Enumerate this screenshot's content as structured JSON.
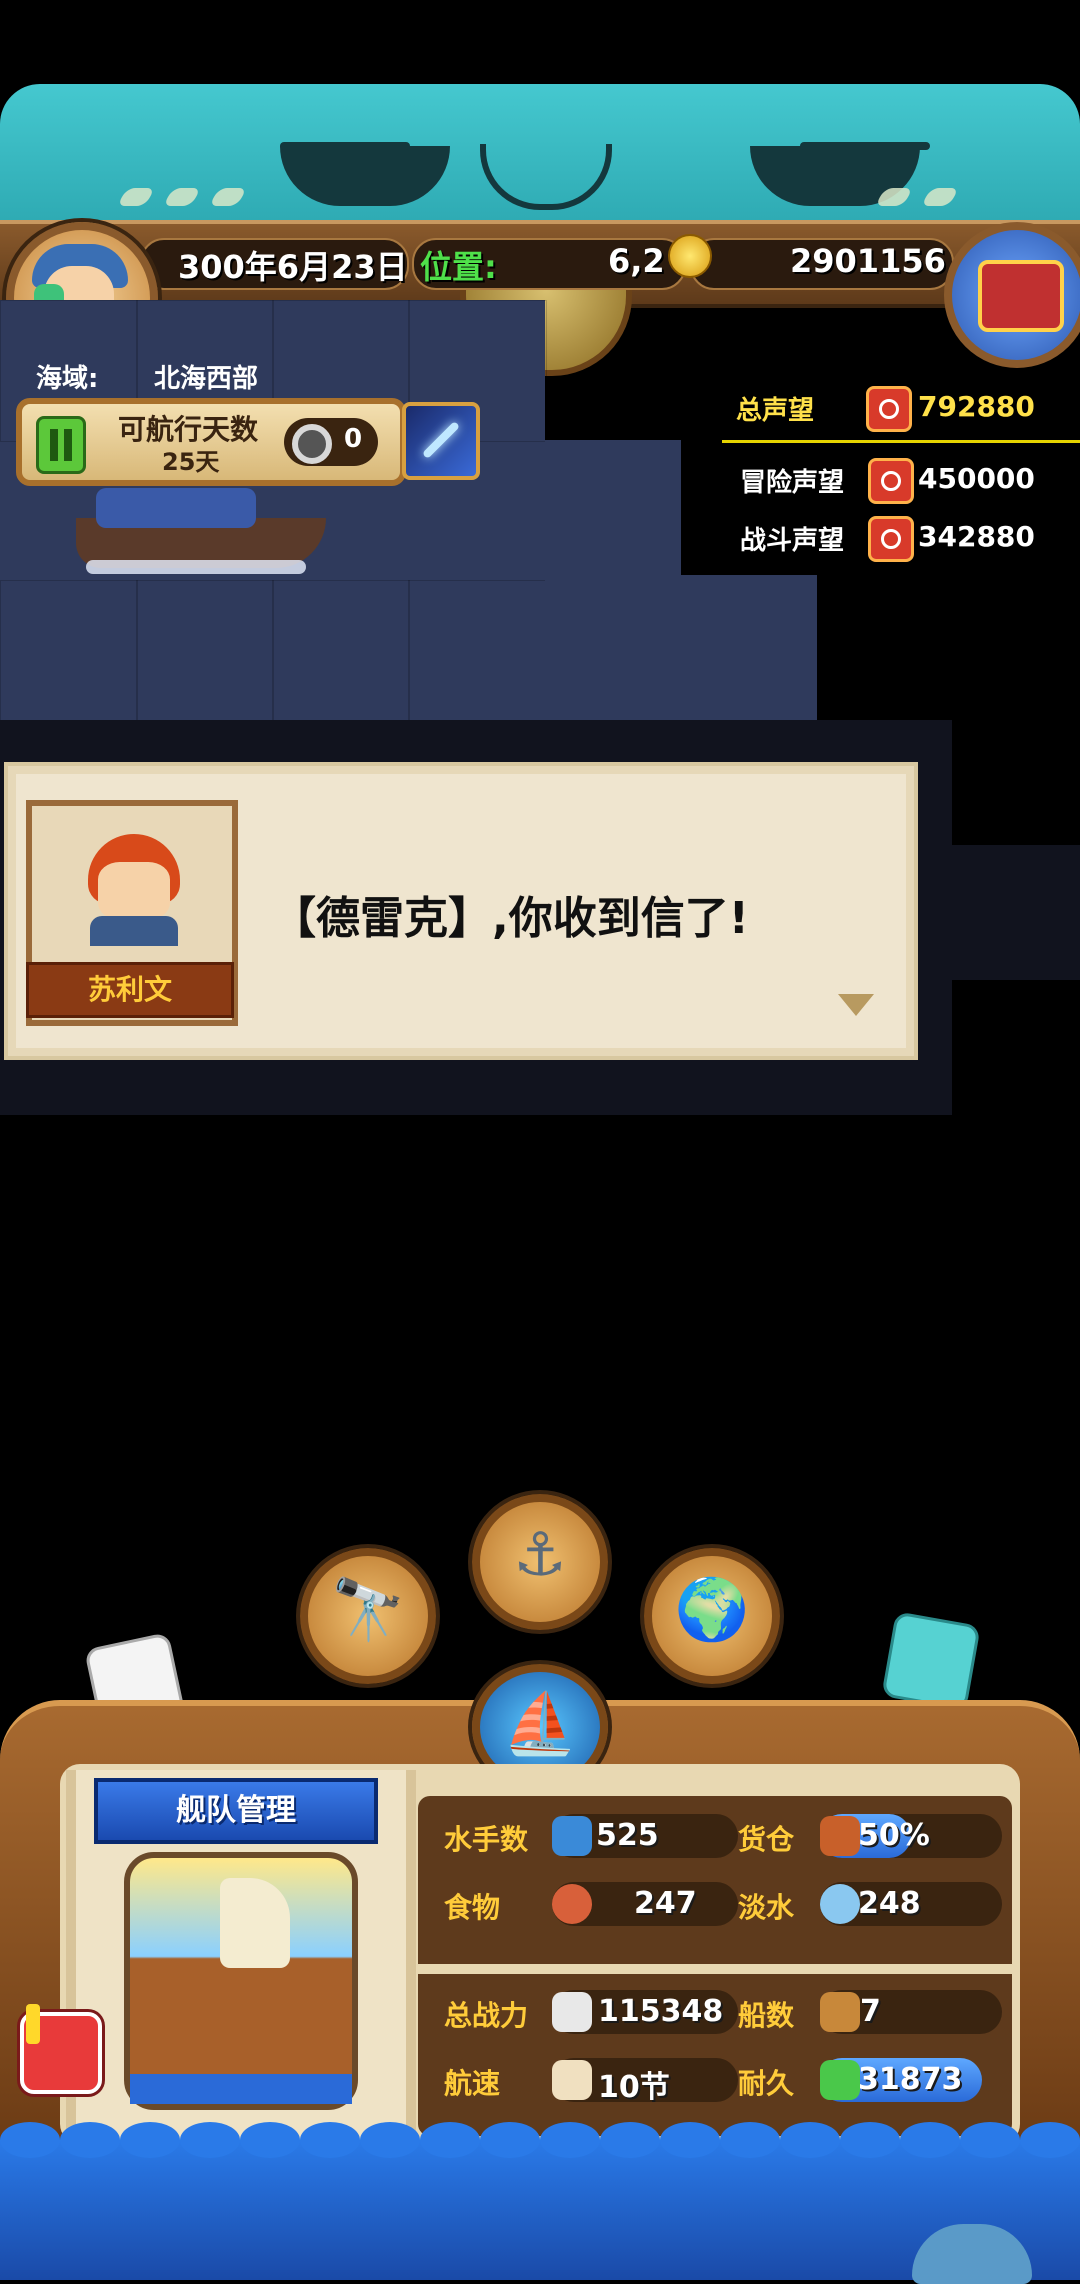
{
  "status": {
    "date": "300年6月23日",
    "position_label": "位置:",
    "position_value": "6,2",
    "gold": "2901156"
  },
  "sea": {
    "label": "海域:",
    "value": "北海西部"
  },
  "sailing": {
    "label": "可航行天数",
    "days": "25天",
    "count": "0"
  },
  "reputation": {
    "total_label": "总声望",
    "total_value": "792880",
    "adventure_label": "冒险声望",
    "adventure_value": "450000",
    "battle_label": "战斗声望",
    "battle_value": "342880",
    "colors": {
      "total": "#ffe14a",
      "other": "#ffffff"
    }
  },
  "dialog": {
    "speaker": "苏利文",
    "text": "【德雷克】,你收到信了!"
  },
  "actions": {
    "spyglass_icon": "spyglass-icon",
    "anchor_icon": "anchor-icon",
    "globe_icon": "globe-icon",
    "sail_icon": "sailboat-icon"
  },
  "fleet": {
    "title": "舰队管理",
    "stats": [
      {
        "label": "水手数",
        "value": "525",
        "icon": "sailor-icon"
      },
      {
        "label": "货仓",
        "value": "50%",
        "icon": "crate-icon",
        "fill": 0.5
      },
      {
        "label": "食物",
        "value": "247",
        "icon": "meat-icon"
      },
      {
        "label": "淡水",
        "value": "248",
        "icon": "water-jug-icon"
      },
      {
        "label": "总战力",
        "value": "115348",
        "icon": "skull-swords-icon"
      },
      {
        "label": "船数",
        "value": "7",
        "icon": "ship-icon"
      },
      {
        "label": "航速",
        "value": "10节",
        "icon": "sail-speed-icon"
      },
      {
        "label": "耐久",
        "value": "31873",
        "icon": "wrench-icon",
        "fill": 1.0
      }
    ]
  }
}
